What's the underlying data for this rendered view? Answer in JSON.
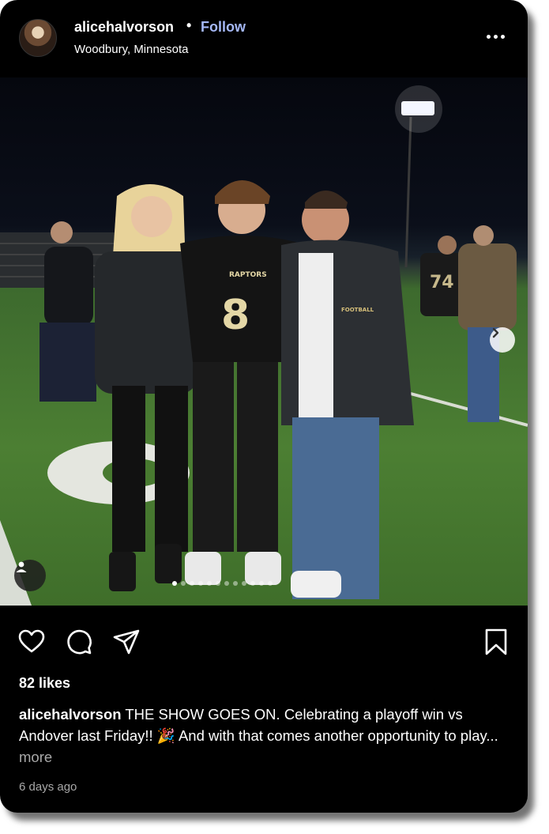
{
  "post": {
    "username": "alicehalvorson",
    "separator": "•",
    "follow_label": "Follow",
    "location": "Woodbury, Minnesota",
    "jersey_team": "RAPTORS",
    "jersey_number": "8",
    "background_number": "74",
    "jacket_logo": "FOOTBALL",
    "carousel": {
      "count": 12,
      "active_index": 0
    },
    "likes": "82 likes",
    "caption_user": "alicehalvorson",
    "caption_text": " THE SHOW GOES ON. Celebrating a playoff win vs Andover last Friday!! 🎉 And with that comes another opportunity to play...",
    "caption_more": " more",
    "timestamp": "6 days ago"
  },
  "icons": {
    "avatar": "profile-avatar",
    "more": "more-horizontal-icon",
    "next": "chevron-right-icon",
    "user_tag": "user-tag-icon",
    "like": "heart-icon",
    "comment": "comment-icon",
    "share": "send-icon",
    "save": "bookmark-icon"
  },
  "colors": {
    "background": "#000000",
    "follow": "#a5b8f6",
    "muted": "#a8a8a8"
  }
}
